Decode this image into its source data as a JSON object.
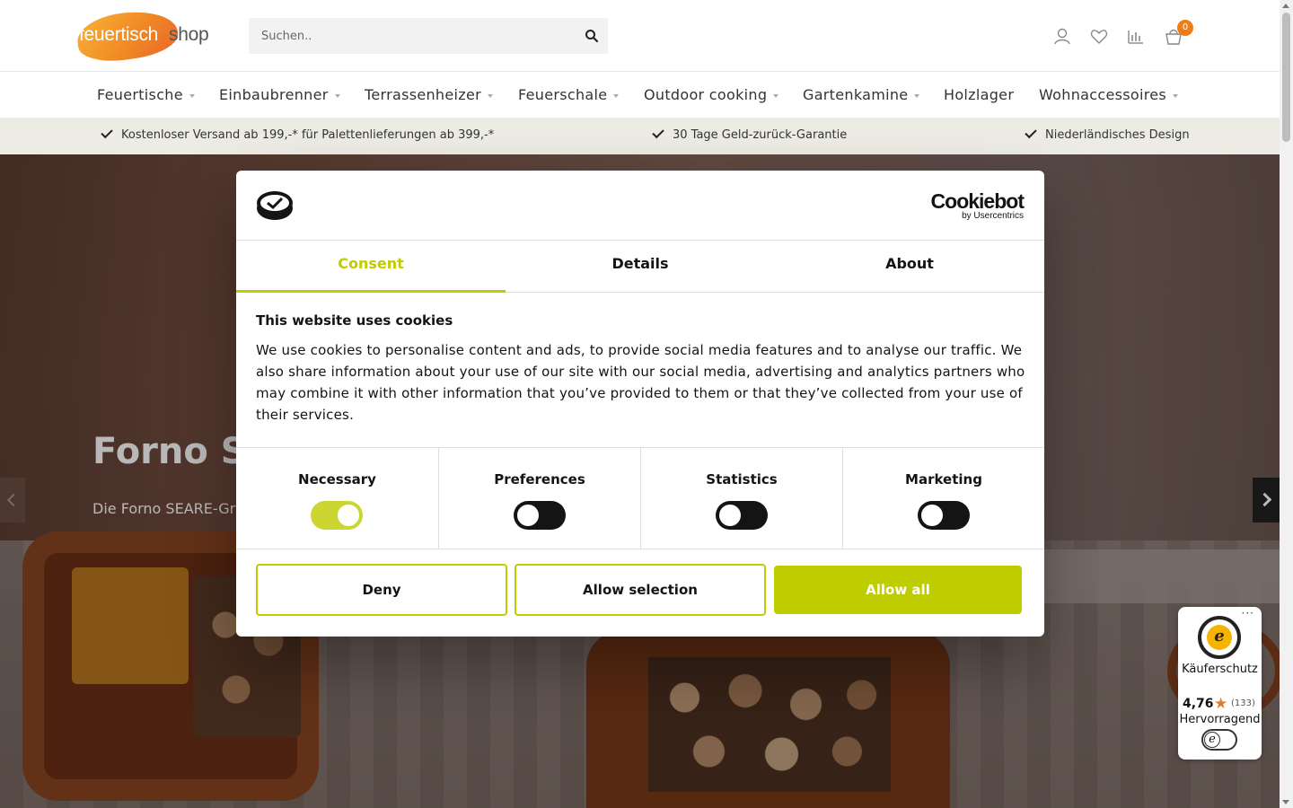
{
  "header": {
    "logo_part1": "feuertisch",
    "logo_part2": "shop",
    "search_placeholder": "Suchen..",
    "cart_count": "0",
    "icons": [
      "account-icon",
      "heart-icon",
      "compare-icon",
      "cart-icon",
      "search-icon"
    ]
  },
  "nav": {
    "items": [
      {
        "label": "Feuertische",
        "has_dropdown": true
      },
      {
        "label": "Einbaubrenner",
        "has_dropdown": true
      },
      {
        "label": "Terrassenheizer",
        "has_dropdown": true
      },
      {
        "label": "Feuerschale",
        "has_dropdown": true
      },
      {
        "label": "Outdoor cooking",
        "has_dropdown": true
      },
      {
        "label": "Gartenkamine",
        "has_dropdown": true
      },
      {
        "label": "Holzlager",
        "has_dropdown": false
      },
      {
        "label": "Wohnaccessoires",
        "has_dropdown": true
      }
    ]
  },
  "usp": {
    "items": [
      "Kostenloser Versand ab 199,-* für Palettenlieferungen ab 399,-*",
      "30 Tage Geld-zurück-Garantie",
      "Niederländisches Design"
    ]
  },
  "hero": {
    "title": "Forno S",
    "subtitle": "Die Forno SEARE-Gr Cortenstahl.andum"
  },
  "cookie_dialog": {
    "brand": "Cookiebot",
    "brand_sub": "by Usercentrics",
    "tabs": [
      {
        "label": "Consent",
        "active": true
      },
      {
        "label": "Details",
        "active": false
      },
      {
        "label": "About",
        "active": false
      }
    ],
    "heading": "This website uses cookies",
    "body": "We use cookies to personalise content and ads, to provide social media features and to analyse our traffic. We also share information about your use of our site with our social media, advertising and analytics partners who may combine it with other information that you’ve provided to them or that they’ve collected from your use of their services.",
    "toggles": [
      {
        "label": "Necessary",
        "on": true
      },
      {
        "label": "Preferences",
        "on": false
      },
      {
        "label": "Statistics",
        "on": false
      },
      {
        "label": "Marketing",
        "on": false
      }
    ],
    "buttons": {
      "deny": "Deny",
      "allow_selection": "Allow selection",
      "allow_all": "Allow all"
    },
    "accent_color": "#bfcc00"
  },
  "trust_badge": {
    "label": "Käuferschutz",
    "score": "4,76",
    "count": "(133)",
    "rating": "Hervorragend"
  }
}
